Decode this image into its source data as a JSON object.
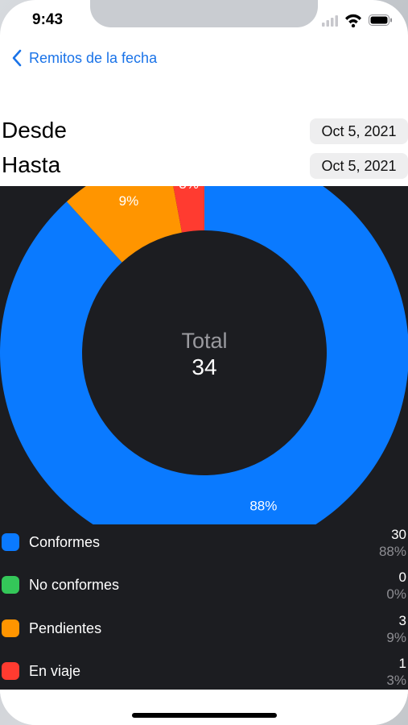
{
  "status_bar": {
    "time": "9:43"
  },
  "nav": {
    "back_label": "Remitos de la fecha"
  },
  "filters": {
    "from_label": "Desde",
    "from_value": "Oct 5, 2021",
    "to_label": "Hasta",
    "to_value": "Oct 5, 2021"
  },
  "chart_data": {
    "type": "pie",
    "donut": true,
    "center_title": "Total",
    "center_value": "34",
    "slices": [
      {
        "name": "Conformes",
        "value": 30,
        "percent_label": "88%",
        "color": "#0a7aff"
      },
      {
        "name": "No conformes",
        "value": 0,
        "percent_label": "0%",
        "color": "#34c759"
      },
      {
        "name": "Pendientes",
        "value": 3,
        "percent_label": "9%",
        "color": "#ff9500"
      },
      {
        "name": "En viaje",
        "value": 1,
        "percent_label": "3%",
        "color": "#ff3b30"
      }
    ],
    "background": "#1c1d21"
  },
  "legend": [
    {
      "label": "Conformes",
      "count": "30",
      "percent": "88%",
      "color": "#0a7aff"
    },
    {
      "label": "No conformes",
      "count": "0",
      "percent": "0%",
      "color": "#34c759"
    },
    {
      "label": "Pendientes",
      "count": "3",
      "percent": "9%",
      "color": "#ff9500"
    },
    {
      "label": "En viaje",
      "count": "1",
      "percent": "3%",
      "color": "#ff3b30"
    }
  ],
  "colors": {
    "accent": "#1a73e8",
    "panel": "#1c1d21"
  },
  "icons": [
    "chevron-left-icon",
    "cellular-signal-icon",
    "wifi-icon",
    "battery-icon"
  ]
}
